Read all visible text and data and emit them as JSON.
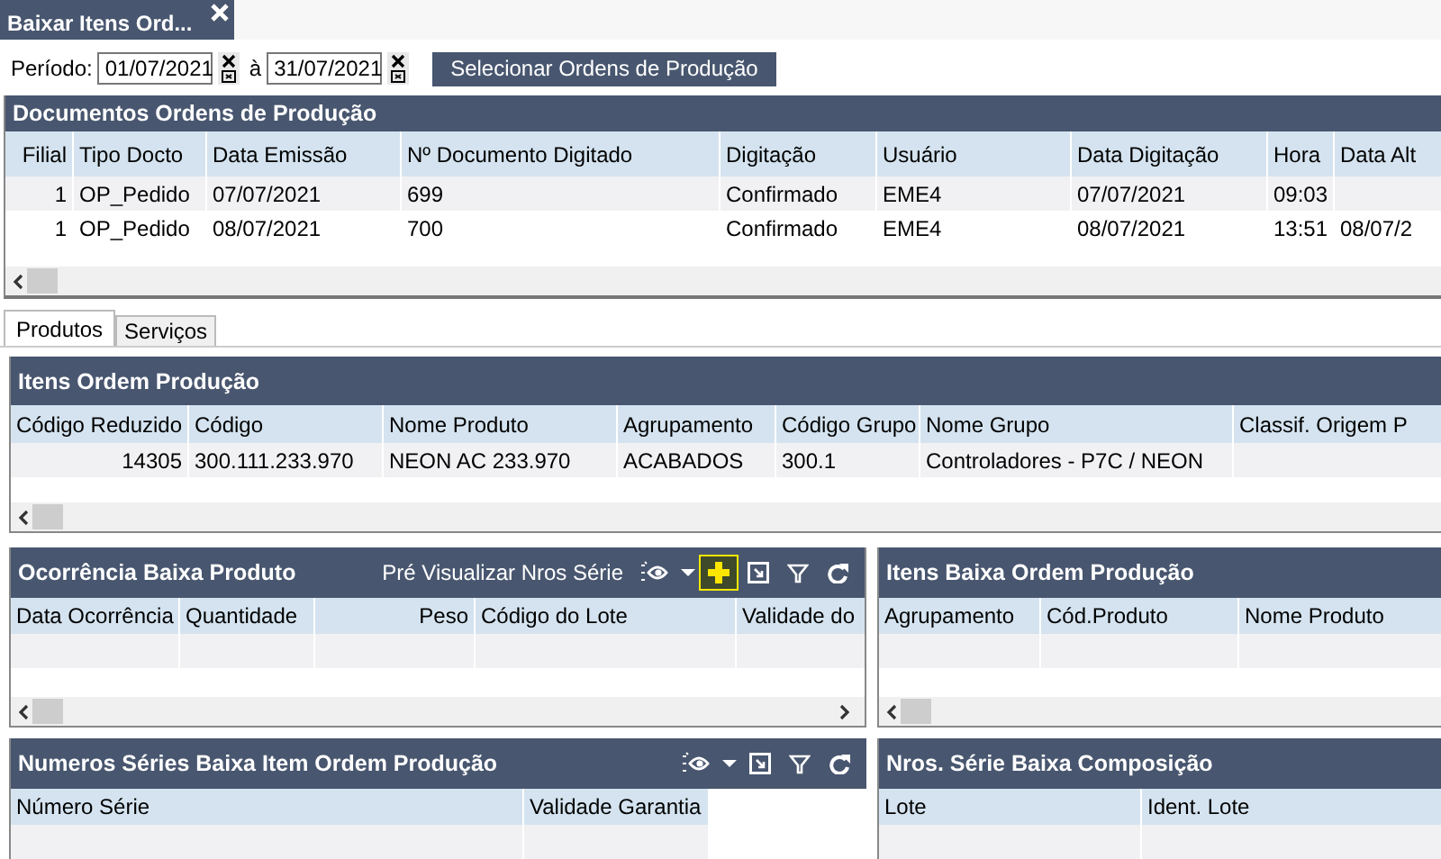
{
  "document_tab": {
    "title": "Baixar Itens Ord..."
  },
  "period": {
    "label": "Período:",
    "from": "01/07/2021",
    "separator": "à",
    "to": "31/07/2021",
    "button": "Selecionar Ordens de Produção"
  },
  "documents": {
    "title": "Documentos Ordens de Produção",
    "columns": [
      "Filial",
      "Tipo Docto",
      "Data Emissão",
      "Nº Documento Digitado",
      "Digitação",
      "Usuário",
      "Data Digitação",
      "Hora",
      "Data Alt"
    ],
    "rows": [
      [
        "1",
        "OP_Pedido",
        "07/07/2021",
        "699",
        "Confirmado",
        "EME4",
        "07/07/2021",
        "09:03"
      ],
      [
        "1",
        "OP_Pedido",
        "08/07/2021",
        "700",
        "Confirmado",
        "EME4",
        "08/07/2021",
        "13:51",
        "08/07/2"
      ]
    ]
  },
  "sub_tabs": [
    {
      "label": "Produtos",
      "selected": true
    },
    {
      "label": "Serviços",
      "selected": false
    }
  ],
  "items": {
    "title": "Itens Ordem Produção",
    "columns": [
      "Código Reduzido",
      "Código",
      "Nome Produto",
      "Agrupamento",
      "Código Grupo",
      "Nome Grupo",
      "Classif. Origem P"
    ],
    "rows": [
      [
        "14305",
        "300.111.233.970",
        "NEON AC 233.970",
        "ACABADOS",
        "300.1",
        "Controladores - P7C / NEON"
      ]
    ]
  },
  "occurrences": {
    "title": "Ocorrência Baixa Produto",
    "toolbar_label": "Pré Visualizar Nros Série",
    "tools": [
      {
        "kind": "visibility",
        "highlighted": false
      },
      {
        "kind": "caret",
        "highlighted": false
      },
      {
        "kind": "add",
        "highlighted": true
      },
      {
        "kind": "export",
        "highlighted": false
      },
      {
        "kind": "filter",
        "highlighted": false
      },
      {
        "kind": "refresh",
        "highlighted": false
      }
    ],
    "columns": [
      "Data Ocorrência",
      "Quantidade",
      "Peso",
      "Código do Lote",
      "Validade do"
    ]
  },
  "serials": {
    "title": "Numeros Séries Baixa Item Ordem Produção",
    "tools": [
      {
        "kind": "visibility",
        "highlighted": false
      },
      {
        "kind": "caret",
        "highlighted": false
      },
      {
        "kind": "export",
        "highlighted": false
      },
      {
        "kind": "filter",
        "highlighted": false
      },
      {
        "kind": "refresh",
        "highlighted": false
      }
    ],
    "columns": [
      "Número Série",
      "Validade Garantia"
    ]
  },
  "batch_items": {
    "title": "Itens Baixa Ordem Produção",
    "columns": [
      "Agrupamento",
      "Cód.Produto",
      "Nome Produto"
    ]
  },
  "batch_serials": {
    "title": "Nros. Série Baixa Composição",
    "columns": [
      "Lote",
      "Ident. Lote"
    ]
  }
}
